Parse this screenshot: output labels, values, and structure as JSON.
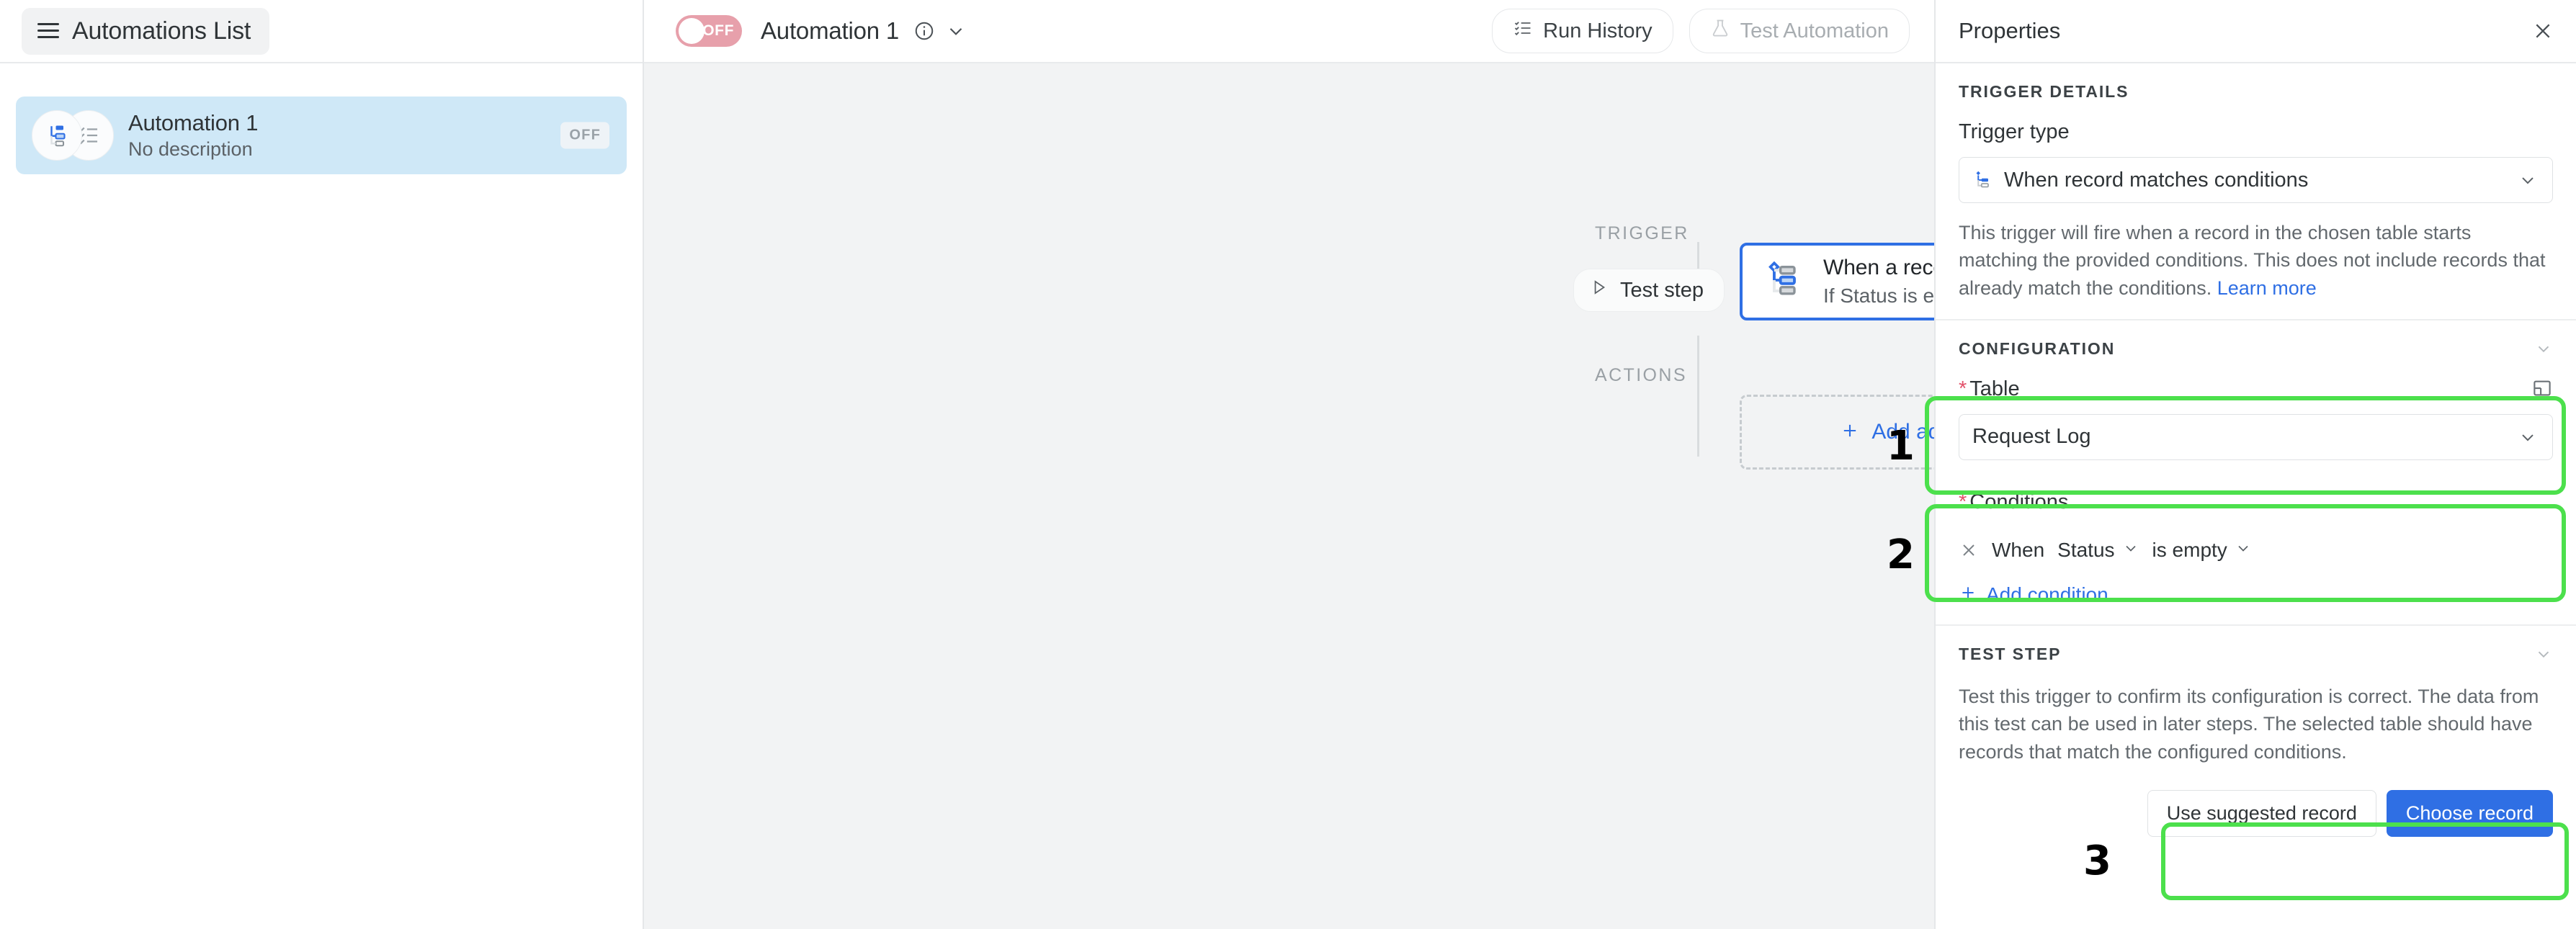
{
  "sidebar": {
    "header_button_label": "Automations List",
    "items": [
      {
        "title": "Automation 1",
        "description": "No description",
        "status_badge": "OFF"
      }
    ]
  },
  "header": {
    "toggle_label": "OFF",
    "automation_title": "Automation 1",
    "run_history_label": "Run History",
    "test_automation_label": "Test Automation"
  },
  "canvas": {
    "trigger_lane_label": "TRIGGER",
    "actions_lane_label": "ACTIONS",
    "test_step_label": "Test step",
    "trigger_card": {
      "title": "When a record matches conditions",
      "subtitle": "If Status is empty"
    },
    "add_action_label": "Add advanced logic or action"
  },
  "properties": {
    "title": "Properties",
    "trigger_details": {
      "heading": "TRIGGER DETAILS",
      "trigger_type_label": "Trigger type",
      "trigger_type_value": "When record matches conditions",
      "helper_text": "This trigger will fire when a record in the chosen table starts matching the provided conditions. This does not include records that already match the conditions. ",
      "helper_link": "Learn more"
    },
    "configuration": {
      "heading": "CONFIGURATION",
      "table_label": "Table",
      "table_value": "Request Log",
      "conditions_label": "Conditions",
      "condition_when": "When",
      "condition_field": "Status",
      "condition_operator": "is empty",
      "add_condition_label": "Add condition"
    },
    "test_step": {
      "heading": "TEST STEP",
      "description": "Test this trigger to confirm its configuration is correct. The data from this test can be used in later steps. The selected table should have records that match the configured conditions.",
      "use_suggested_label": "Use suggested record",
      "choose_record_label": "Choose record"
    }
  },
  "annotations": {
    "marker_1": "1",
    "marker_2": "2",
    "marker_3": "3",
    "highlight_color": "#4ce04c"
  },
  "colors": {
    "accent_blue": "#2f6fe4",
    "toggle_off_pink": "#e7a0ab",
    "selected_item_blue": "#cfe8f7",
    "required_star_red": "#e2526a"
  }
}
